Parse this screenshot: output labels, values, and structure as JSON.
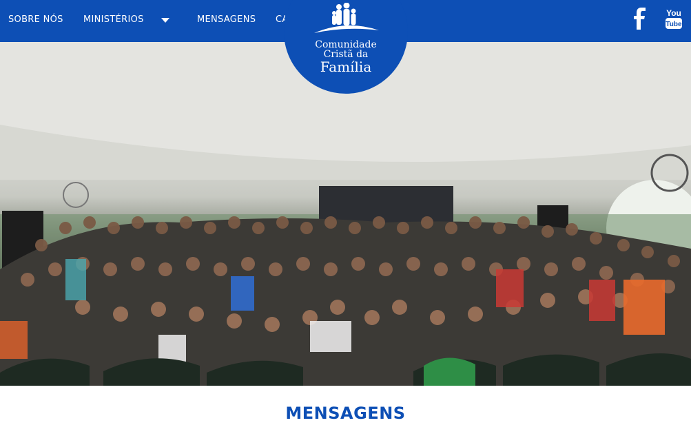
{
  "nav": {
    "items": [
      {
        "label": "SOBRE NÓS"
      },
      {
        "label": "MINISTÉRIOS"
      },
      {
        "label": "MENSAGENS"
      },
      {
        "label": "CA"
      }
    ]
  },
  "logo": {
    "line1": "Comunidade",
    "line2": "Cristã da",
    "line3": "Família"
  },
  "social": {
    "facebook_glyph": "f",
    "youtube_text": "You",
    "youtube_icon": "youtube-icon",
    "facebook_icon": "facebook-icon"
  },
  "page": {
    "section_title": "MENSAGENS"
  },
  "colors": {
    "brand_blue": "#0d4fb5",
    "text_on_brand": "#ffffff",
    "page_background": "#ffffff"
  }
}
